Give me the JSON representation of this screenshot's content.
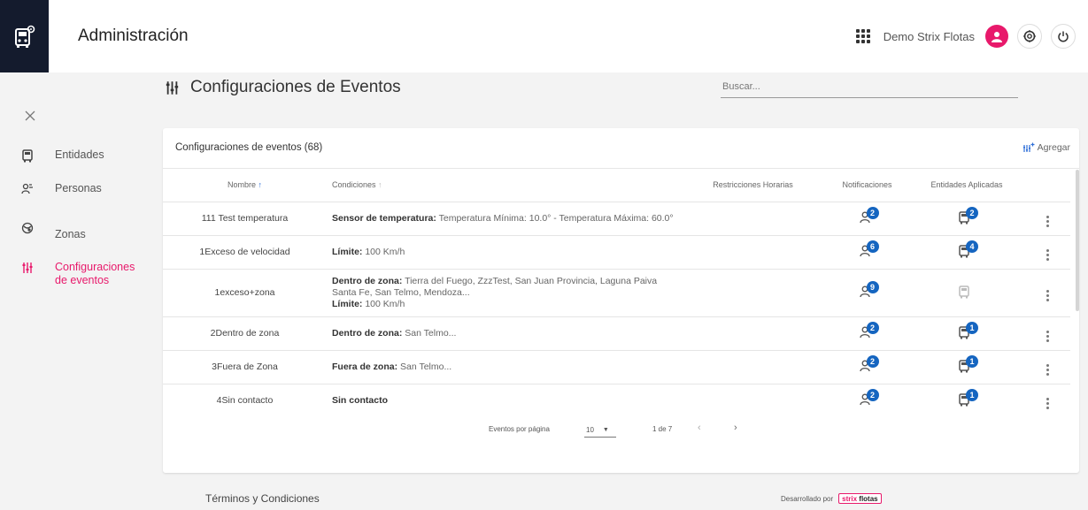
{
  "app": {
    "title": "Administración",
    "user_name": "Demo Strix Flotas"
  },
  "sidebar": {
    "items": [
      {
        "label": "Entidades",
        "icon": "vehicle-icon"
      },
      {
        "label": "Personas",
        "icon": "users-icon"
      },
      {
        "label": "Zonas",
        "icon": "zones-icon"
      },
      {
        "label": "Configuraciones de eventos",
        "icon": "settings-sliders-icon",
        "active": true
      }
    ]
  },
  "page": {
    "title": "Configuraciones de Eventos",
    "search_placeholder": "Buscar..."
  },
  "card": {
    "title": "Configuraciones de eventos (68)",
    "add_label": "Agregar"
  },
  "table": {
    "columns": {
      "name": "Nombre",
      "conditions": "Condiciones",
      "restrictions": "Restricciones Horarias",
      "notifications": "Notificaciones",
      "entities": "Entidades Aplicadas"
    },
    "rows": [
      {
        "name": "111 Test temperatura",
        "cond_label": "Sensor de temperatura:",
        "cond_text": "Temperatura Mínima: 10.0° - Temperatura Máxima: 60.0°",
        "cond2_label": "",
        "cond2_text": "",
        "notif": "2",
        "ent": "2"
      },
      {
        "name": "1Exceso de velocidad",
        "cond_label": "Límite:",
        "cond_text": "100 Km/h",
        "cond2_label": "",
        "cond2_text": "",
        "notif": "6",
        "ent": "4"
      },
      {
        "name": "1exceso+zona",
        "cond_label": "Dentro de zona:",
        "cond_text": "Tierra del Fuego, ZzzTest, San Juan Provincia, Laguna Paiva Santa Fe, San Telmo, Mendoza...",
        "cond2_label": "Límite:",
        "cond2_text": "100 Km/h",
        "notif": "9",
        "ent": ""
      },
      {
        "name": "2Dentro de zona",
        "cond_label": "Dentro de zona:",
        "cond_text": "San Telmo...",
        "cond2_label": "",
        "cond2_text": "",
        "notif": "2",
        "ent": "1"
      },
      {
        "name": "3Fuera de Zona",
        "cond_label": "Fuera de zona:",
        "cond_text": "San Telmo...",
        "cond2_label": "",
        "cond2_text": "",
        "notif": "2",
        "ent": "1"
      },
      {
        "name": "4Sin contacto",
        "cond_label": "Sin contacto",
        "cond_text": "",
        "cond2_label": "",
        "cond2_text": "",
        "notif": "2",
        "ent": "1"
      }
    ]
  },
  "pagination": {
    "label": "Eventos por página",
    "per_page": "10",
    "range": "1 de 7"
  },
  "footer": {
    "terms": "Términos y Condiciones",
    "developed_by": "Desarrollado por",
    "brand_a": "strix",
    "brand_b": "flotas"
  },
  "colors": {
    "accent": "#e8196b",
    "badge": "#1565c0",
    "logo_bg": "#141b2d"
  }
}
